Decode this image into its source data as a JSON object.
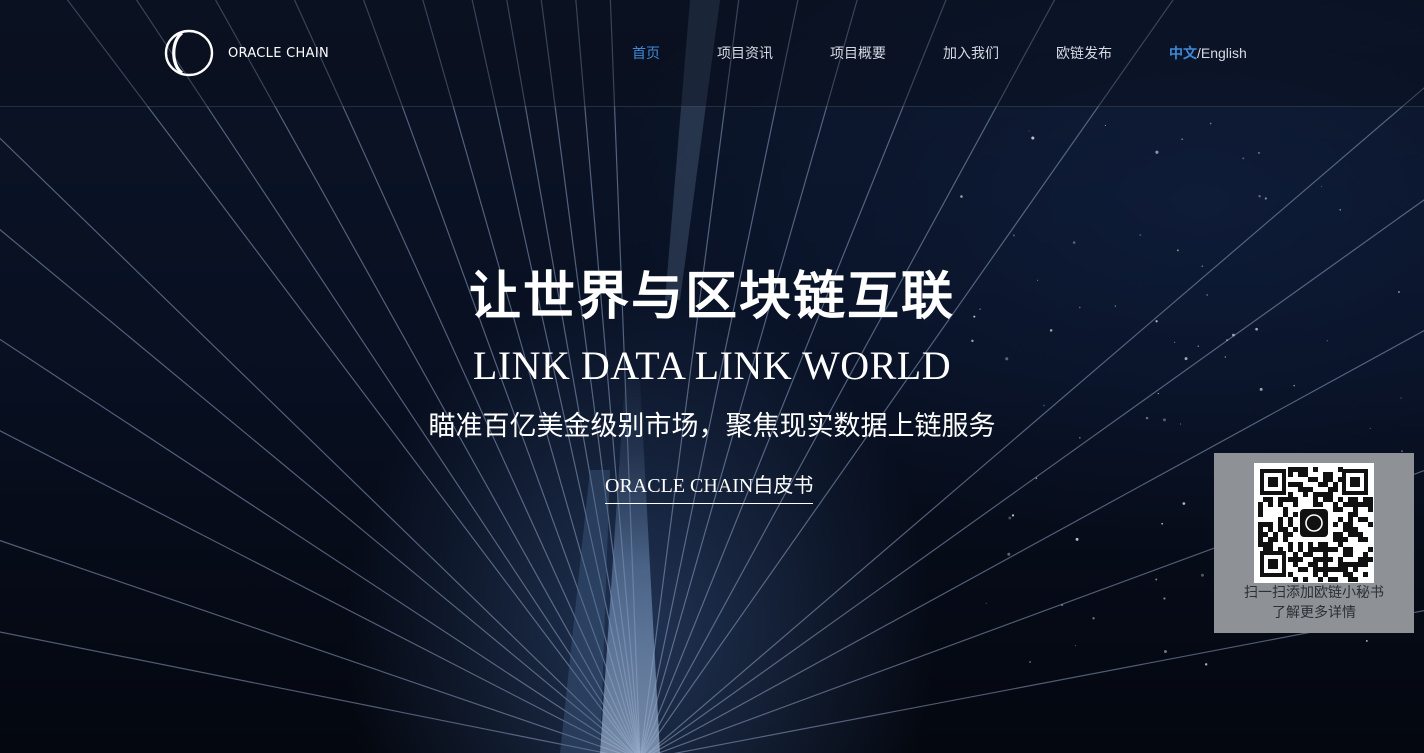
{
  "header": {
    "logo_text": "ORACLE CHAIN",
    "nav": [
      {
        "label": "首页",
        "active": true
      },
      {
        "label": "项目资讯",
        "active": false
      },
      {
        "label": "项目概要",
        "active": false
      },
      {
        "label": "加入我们",
        "active": false
      },
      {
        "label": "欧链发布",
        "active": false
      }
    ],
    "lang_current": "中文",
    "lang_separator": "/",
    "lang_other": "English"
  },
  "hero": {
    "headline": "让世界与区块链互联",
    "slogan": "LINK DATA LINK WORLD",
    "subtitle": "瞄准百亿美金级别市场，聚焦现实数据上链服务",
    "whitepaper_link": "ORACLE CHAIN白皮书"
  },
  "qr_panel": {
    "line1": "扫一扫添加欧链小秘书",
    "line2": "了解更多详情"
  },
  "colors": {
    "accent": "#3f8ad8",
    "nav_text": "#d6dae2",
    "panel_bg": "#8e9196"
  },
  "icons": {
    "logo": "oracle-chain-ring-logo",
    "qr": "qr-code"
  }
}
